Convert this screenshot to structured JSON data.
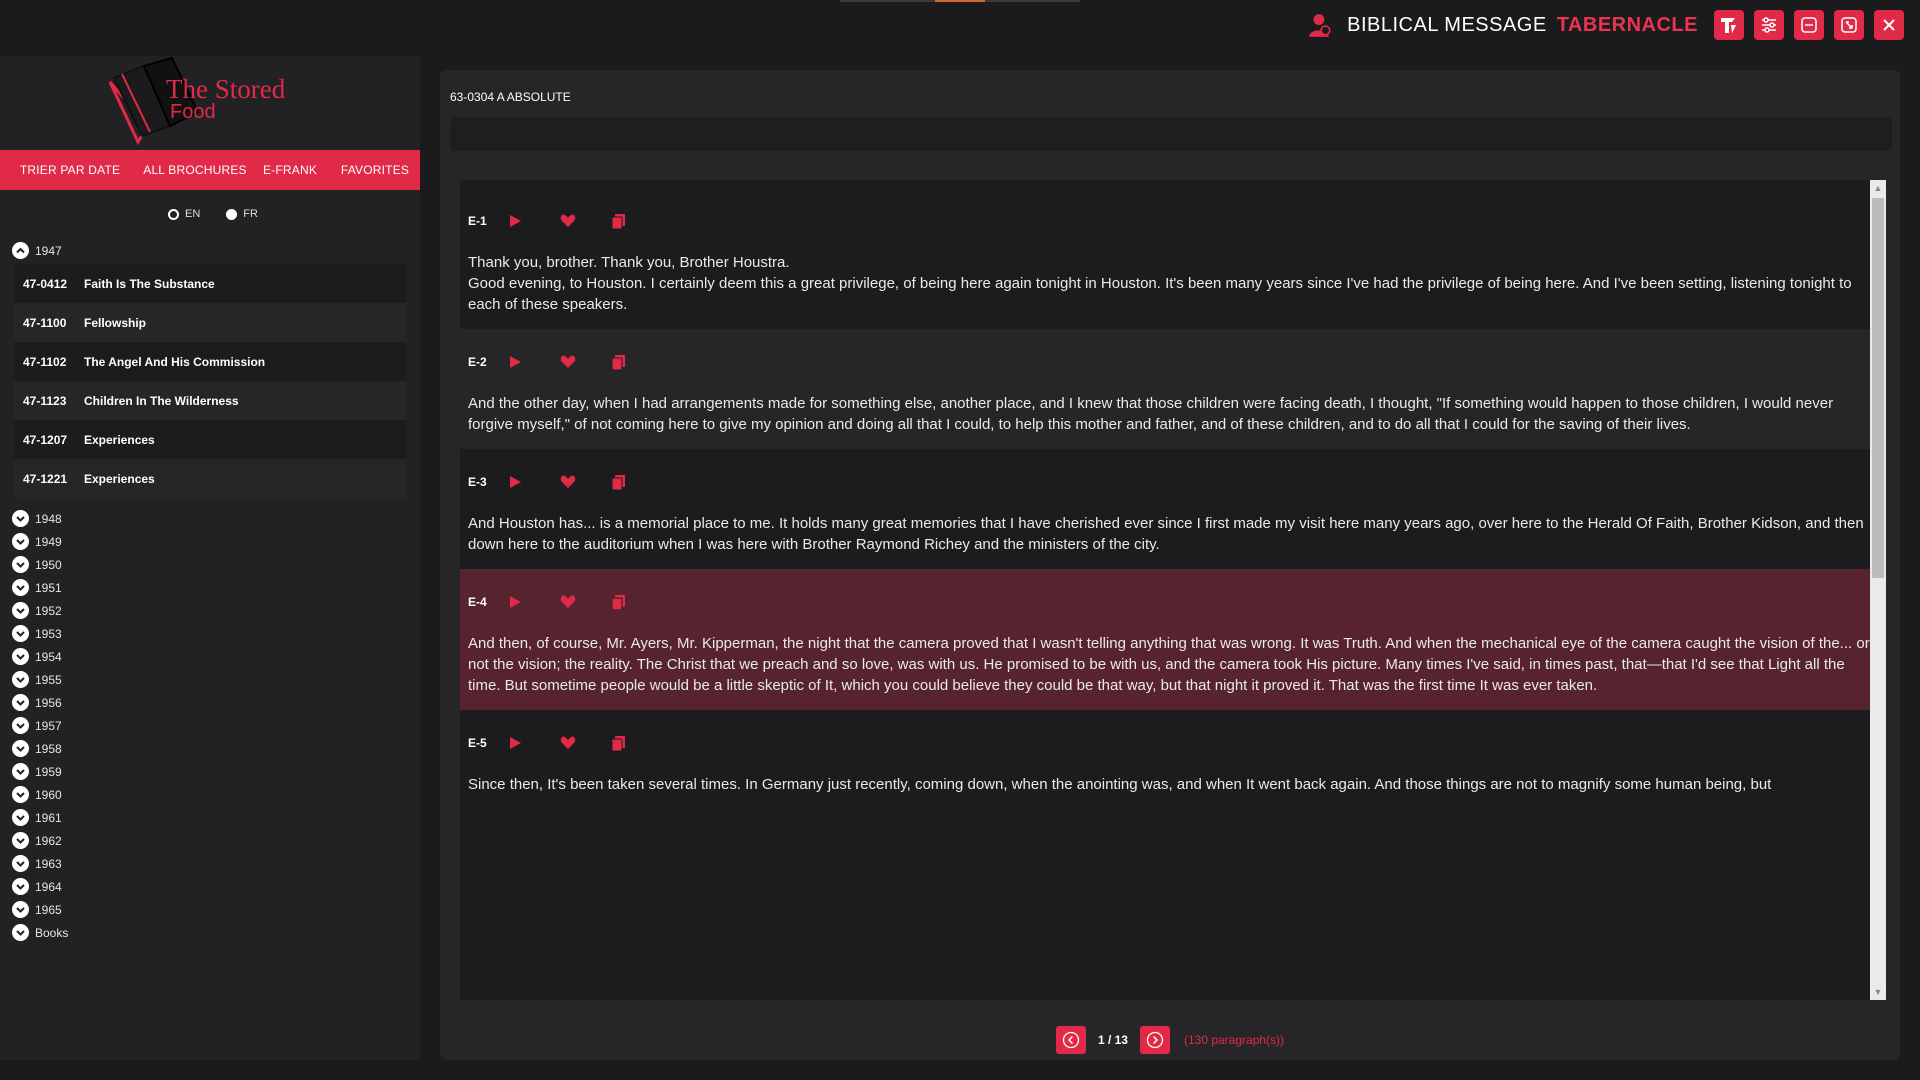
{
  "app": {
    "brand_prefix": "BIBLICAL MESSAGE",
    "brand_suffix": "TABERNACLE",
    "logo_line1": "The Stored",
    "logo_line2": "Food"
  },
  "nav": {
    "items": [
      "TRIER PAR DATE",
      "ALL BROCHURES",
      "E-FRANK",
      "FAVORITES"
    ]
  },
  "lang": {
    "en": "EN",
    "fr": "FR",
    "selected": "EN"
  },
  "years": {
    "expanded": "1947",
    "collapsed": [
      "1948",
      "1949",
      "1950",
      "1951",
      "1952",
      "1953",
      "1954",
      "1955",
      "1956",
      "1957",
      "1958",
      "1959",
      "1960",
      "1961",
      "1962",
      "1963",
      "1964",
      "1965",
      "Books"
    ]
  },
  "sermons": [
    {
      "code": "47-0412",
      "title": "Faith Is The Substance"
    },
    {
      "code": "47-1100",
      "title": "Fellowship"
    },
    {
      "code": "47-1102",
      "title": "The Angel And His Commission"
    },
    {
      "code": "47-1123",
      "title": "Children In The Wilderness"
    },
    {
      "code": "47-1207",
      "title": "Experiences"
    },
    {
      "code": "47-1221",
      "title": "Experiences"
    }
  ],
  "main": {
    "sermon_title": "63-0304 A ABSOLUTE",
    "paragraphs": [
      {
        "num": "E-1",
        "text": "Thank you, brother. Thank you, Brother Houstra.\nGood evening, to Houston. I certainly deem this a great privilege, of being here again tonight in Houston. It's been many years since I've had the privilege of being here. And I've been setting, listening tonight to each of these speakers."
      },
      {
        "num": "E-2",
        "text": "And the other day, when I had arrangements made for something else, another place, and I knew that those children were facing death, I thought, \"If something would happen to those children, I would never forgive myself,\" of not coming here to give my opinion and doing all that I could, to help this mother and father, and of these children, and to do all that I could for the saving of their lives."
      },
      {
        "num": "E-3",
        "text": "And Houston has... is a memorial place to me. It holds many great memories that I have cherished ever since I first made my visit here many years ago, over here to the Herald Of Faith, Brother Kidson, and then down here to the auditorium when I was here with Brother Raymond Richey and the ministers of the city."
      },
      {
        "num": "E-4",
        "text": "And then, of course, Mr. Ayers, Mr. Kipperman, the night that the camera proved that I wasn't telling anything that was wrong. It was Truth. And when the mechanical eye of the camera caught the vision of the... or, not the vision; the reality. The Christ that we preach and so love, was with us. He promised to be with us, and the camera took His picture. Many times I've said, in times past, that—that I'd see that Light all the time. But sometime people would be a little skeptic of It, which you could believe they could be that way, but that night it proved it. That was the first time It was ever taken."
      },
      {
        "num": "E-5",
        "text": "Since then, It's been taken several times. In Germany just recently, coming down, when the anointing was, and when It went back again. And those things are not to magnify some human being, but"
      }
    ]
  },
  "pager": {
    "page": "1 / 13",
    "count": "(130 paragraph(s))"
  },
  "colors": {
    "accent": "#e02a48",
    "highlight": "#56232f"
  }
}
